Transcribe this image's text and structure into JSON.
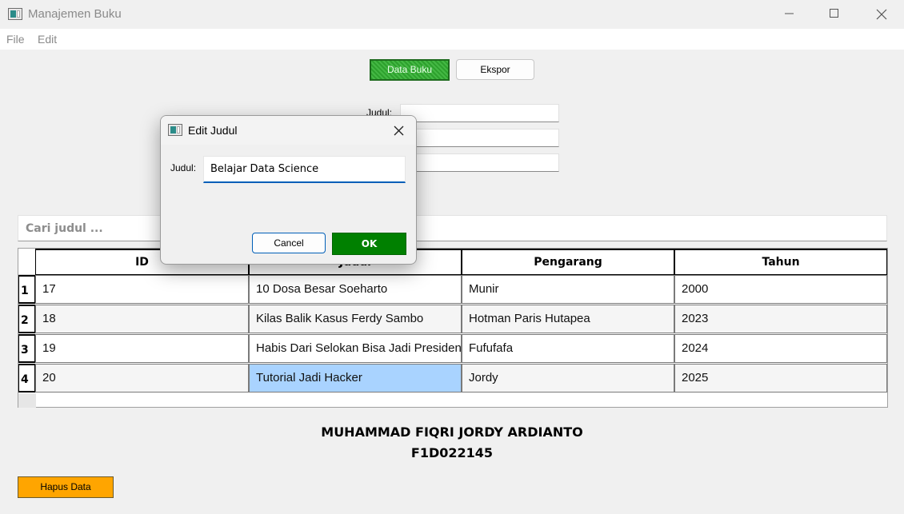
{
  "window": {
    "title": "Manajemen Buku",
    "icon": "app-window-icon"
  },
  "menu": {
    "items": [
      "File",
      "Edit"
    ]
  },
  "toolbar": {
    "data_buku_label": "Data Buku",
    "ekspor_label": "Ekspor",
    "data_buku_color": "#2da02d"
  },
  "form": {
    "judul_label": "Judul:"
  },
  "search": {
    "placeholder": "Cari judul ..."
  },
  "table": {
    "columns": [
      "ID",
      "Judul",
      "Pengarang",
      "Tahun"
    ],
    "row_headers": [
      "1",
      "2",
      "3",
      "4"
    ],
    "rows": [
      {
        "id": "17",
        "judul": "10 Dosa Besar Soeharto",
        "pengarang": "Munir",
        "tahun": "2000"
      },
      {
        "id": "18",
        "judul": "Kilas Balik Kasus Ferdy Sambo",
        "pengarang": "Hotman Paris Hutapea",
        "tahun": "2023"
      },
      {
        "id": "19",
        "judul": "Habis Dari Selokan Bisa Jadi Presiden",
        "pengarang": "Fufufafa",
        "tahun": "2024"
      },
      {
        "id": "20",
        "judul": "Tutorial Jadi Hacker",
        "pengarang": "Jordy",
        "tahun": "2025"
      }
    ],
    "selected_color": "#a9d3ff"
  },
  "footer": {
    "name": "MUHAMMAD FIQRI JORDY ARDIANTO",
    "student_id": "F1D022145",
    "hapus_label": "Hapus Data",
    "hapus_color": "#ffa500"
  },
  "dialog": {
    "title": "Edit Judul",
    "judul_label": "Judul:",
    "judul_value": "Belajar Data Science",
    "cancel_label": "Cancel",
    "ok_label": "OK",
    "ok_color": "#008000"
  }
}
